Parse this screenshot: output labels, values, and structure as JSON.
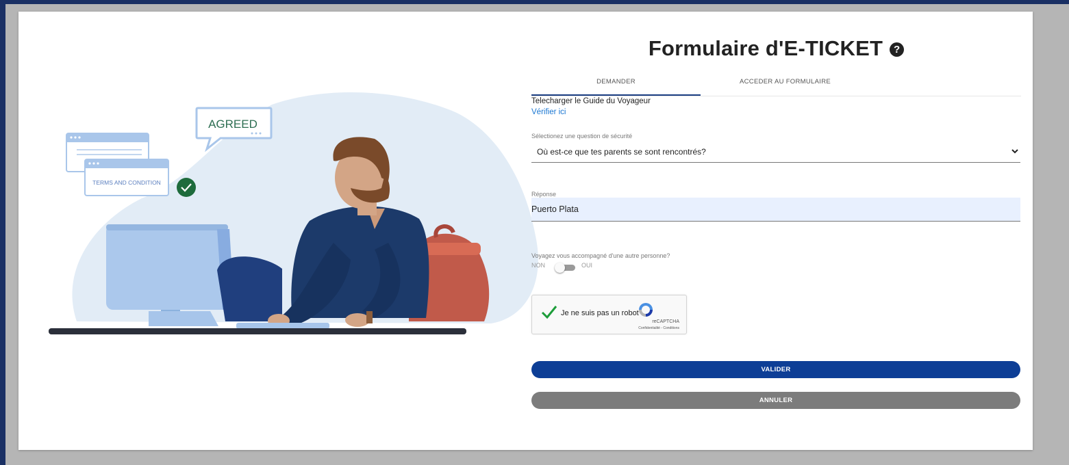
{
  "form": {
    "title": "Formulaire d'E-TICKET",
    "help_glyph": "?",
    "tabs": [
      {
        "label": "DEMANDER",
        "active": true
      },
      {
        "label": "ACCEDER AU FORMULAIRE",
        "active": false
      }
    ],
    "guide_text": "Telecharger le Guide du Voyageur",
    "guide_link": "Vérifier ici",
    "security_question": {
      "label": "Sélectionez une question de sécurité",
      "value": "Où est-ce que tes parents se sont rencontrés?"
    },
    "answer": {
      "label": "Réponse",
      "value": "Puerto Plata"
    },
    "companion": {
      "label": "Voyagez vous accompagné d'une autre personne?",
      "off_label": "NON",
      "on_label": "OUI",
      "checked": false
    },
    "captcha": {
      "label": "Je ne suis pas un robot",
      "brand": "reCAPTCHA",
      "terms": "Confidentialité - Conditions"
    },
    "submit_label": "VALIDER",
    "cancel_label": "ANNULER"
  },
  "illustration": {
    "agreed_text": "AGREED",
    "terms_text": "TERMS AND CONDITION"
  },
  "colors": {
    "frame": "#1a3064",
    "primary_button": "#0d3e96",
    "secondary_button": "#7c7c7c",
    "link": "#1976d2",
    "input_bg": "#e8f0fe"
  }
}
